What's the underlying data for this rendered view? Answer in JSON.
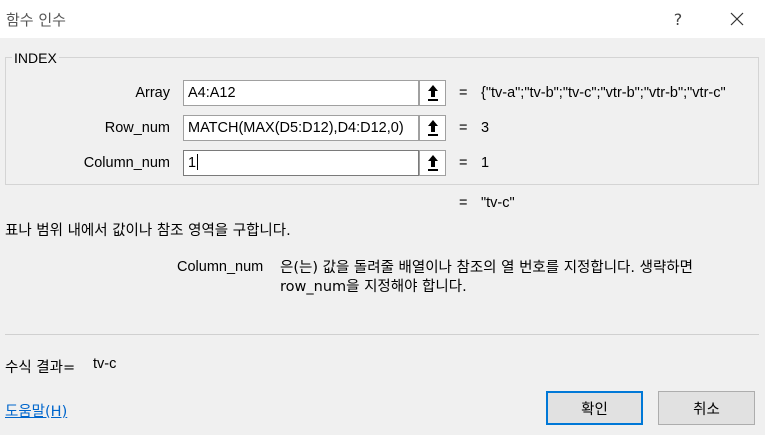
{
  "window": {
    "title": "함수 인수",
    "help_glyph": "?",
    "close_icon": "close-icon"
  },
  "function": {
    "name": "INDEX"
  },
  "arguments": [
    {
      "label": "Array",
      "value": "A4:A12",
      "result": "{\"tv-a\";\"tv-b\";\"tv-c\";\"vtr-b\";\"vtr-b\";\"vtr-c\""
    },
    {
      "label": "Row_num",
      "value": "MATCH(MAX(D5:D12),D4:D12,0)",
      "result": "3"
    },
    {
      "label": "Column_num",
      "value": "1",
      "result": "1"
    }
  ],
  "equals_sign": "=",
  "result": "\"tv-c\"",
  "description": {
    "main": "표나 범위 내에서 값이나 참조 영역을 구합니다.",
    "arg_name": "Column_num",
    "arg_text": "은(는) 값을 돌려줄 배열이나 참조의 열 번호를 지정합니다. 생략하면 row_num을 지정해야 합니다."
  },
  "formula_result": {
    "label": "수식 결과=",
    "value": "tv-c"
  },
  "footer": {
    "help_link": "도움말(H)",
    "ok_label": "확인",
    "cancel_label": "취소"
  },
  "colors": {
    "accent": "#0078d7",
    "link": "#0066cc",
    "dialog_bg": "#f0f0f0"
  }
}
